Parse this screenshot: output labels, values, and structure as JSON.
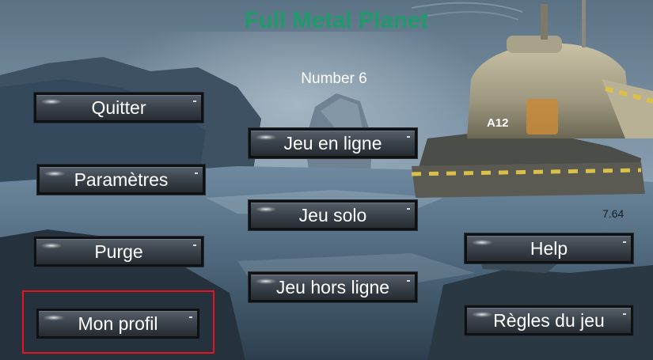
{
  "header": {
    "title": "Full Metal Planet",
    "subtitle": "Number 6"
  },
  "version": "7.64",
  "menu": {
    "left": {
      "quit": "Quitter",
      "settings": "Paramètres",
      "purge": "Purge",
      "profile": "Mon profil"
    },
    "center": {
      "online": "Jeu en ligne",
      "solo": "Jeu solo",
      "offline": "Jeu hors ligne"
    },
    "right": {
      "help": "Help",
      "rules": "Règles du jeu"
    }
  },
  "colors": {
    "title": "#1f9a6a",
    "highlight": "#e8141b",
    "button": "#3c444d"
  }
}
